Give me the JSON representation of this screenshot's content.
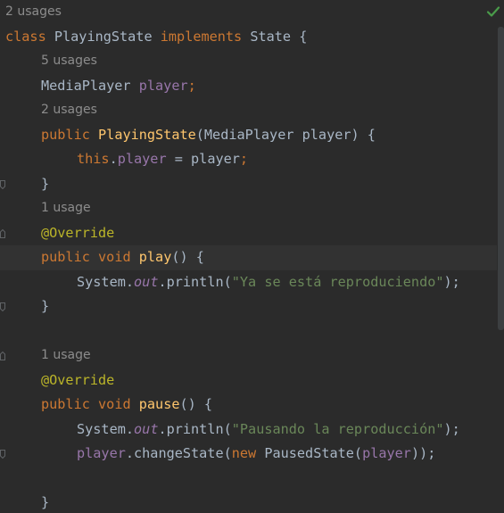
{
  "hints": {
    "class_usages": "2 usages",
    "field_usages": "5 usages",
    "ctor_usages": "2 usages",
    "play_usages": "1 usage",
    "pause_usages": "1 usage"
  },
  "code": {
    "class_kw": "class",
    "class_name": "PlayingState",
    "implements_kw": "implements",
    "interface_name": "State",
    "open_brace": "{",
    "field_type": "MediaPlayer",
    "field_name": "player",
    "semicolon": ";",
    "public_kw": "public",
    "ctor_name": "PlayingState",
    "ctor_params_open": "(MediaPlayer player) {",
    "this_kw": "this",
    "dot": ".",
    "assign_field": "player",
    "assign_rest": " = player",
    "close_brace": "}",
    "override_ann": "@Override",
    "void_kw": "void",
    "play_name": "play",
    "play_params": "() {",
    "system": "System",
    "out": "out",
    "println_open": ".println(",
    "play_string": "\"Ya se está reproduciendo\"",
    "close_call": ");",
    "pause_name": "pause",
    "pause_string": "\"Pausando la reproducción\"",
    "player_ref": "player",
    "change_state_open": ".changeState(",
    "new_kw": "new",
    "paused_state_open": " PausedState(",
    "player_arg": "player",
    "double_close": "));"
  },
  "colors": {
    "background": "#2b2b2b",
    "keyword": "#cc7832",
    "function": "#ffc66d",
    "field": "#9876aa",
    "string": "#6a8759",
    "annotation": "#bbb529",
    "text": "#a9b7c6",
    "hint": "#8c8c8c",
    "check": "#4a9c4a"
  },
  "icons": {
    "status": "check-icon",
    "gutter": "bookmark-fold-icon"
  }
}
